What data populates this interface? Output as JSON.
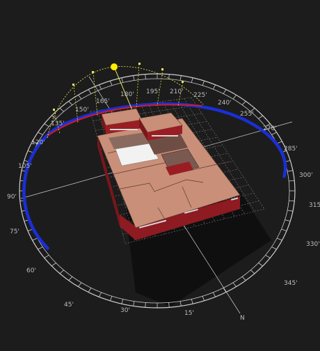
{
  "compass": {
    "north_label": "N",
    "azimuth_labels": [
      "15'",
      "30'",
      "45'",
      "60'",
      "75'",
      "90'",
      "105'",
      "120'",
      "135'",
      "150'",
      "165'",
      "180'",
      "195'",
      "210'",
      "225'",
      "240'",
      "255'",
      "270'",
      "285'",
      "300'",
      "315'",
      "330'",
      "345'"
    ]
  },
  "colors": {
    "background": "#1c1c1c",
    "sun": "#ffee00",
    "sun_path": "#d8d84a",
    "sunlight_arc_blue": "#1a2fd6",
    "sunlight_arc_red": "#d01c24",
    "roof": "#c98f78",
    "wall": "#9a1d24",
    "glass": "#f2f2f2"
  },
  "icons": {
    "sun": "sun-icon",
    "north": "north-marker"
  }
}
